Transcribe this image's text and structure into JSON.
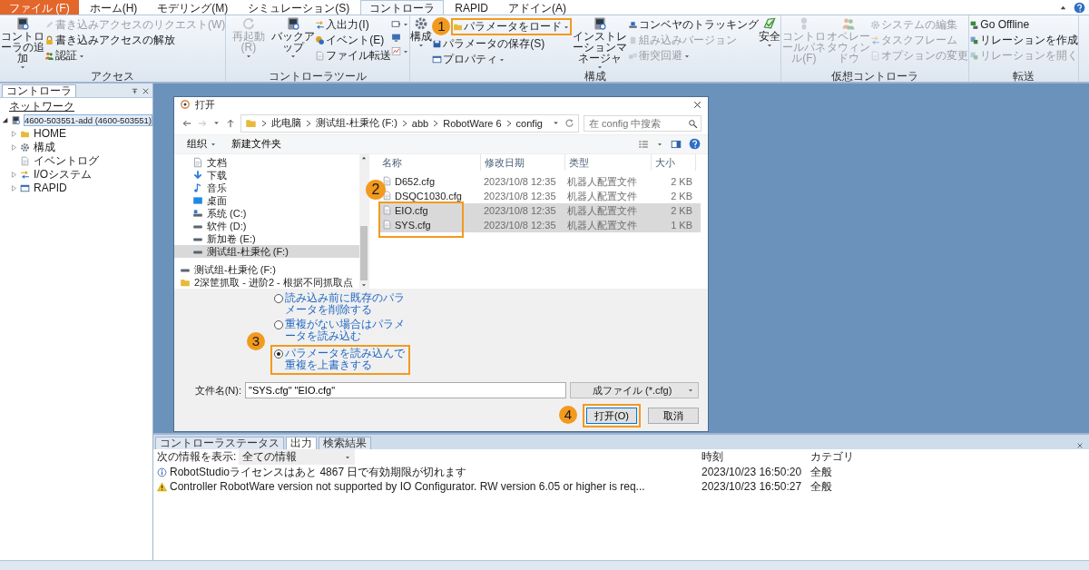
{
  "ribbon": {
    "tabs": [
      {
        "label": "ファイル (F)",
        "kind": "app",
        "selected": false
      },
      {
        "label": "ホーム(H)",
        "kind": "tab",
        "selected": false
      },
      {
        "label": "モデリング(M)",
        "kind": "tab",
        "selected": false
      },
      {
        "label": "シミュレーション(S)",
        "kind": "tab",
        "selected": false
      },
      {
        "label": "コントローラ",
        "kind": "tab",
        "selected": true
      },
      {
        "label": "RAPID",
        "kind": "tab",
        "selected": false
      },
      {
        "label": "アドイン(A)",
        "kind": "tab",
        "selected": false
      }
    ],
    "groups": [
      {
        "title": "アクセス",
        "items": [
          {
            "kind": "large",
            "buttons": [
              {
                "label": "コントローラの追加",
                "disabled": false,
                "dropdown": true
              }
            ]
          },
          {
            "kind": "stack",
            "buttons": [
              {
                "label": "書き込みアクセスのリクエスト(W)",
                "disabled": true,
                "dropdown": false
              },
              {
                "label": "書き込みアクセスの解放",
                "disabled": false,
                "dropdown": false
              },
              {
                "label": "認証",
                "disabled": false,
                "dropdown": true
              }
            ]
          }
        ]
      },
      {
        "title": "コントローラツール",
        "items": [
          {
            "kind": "large",
            "buttons": [
              {
                "label": "再起動(R)",
                "disabled": true,
                "dropdown": true
              }
            ]
          },
          {
            "kind": "large",
            "buttons": [
              {
                "label": "バックアップ",
                "disabled": false,
                "dropdown": true
              }
            ]
          },
          {
            "kind": "stack",
            "buttons": [
              {
                "label": "入出力(I)",
                "disabled": false,
                "dropdown": false
              },
              {
                "label": "イベント(E)",
                "disabled": false,
                "dropdown": false
              },
              {
                "label": "ファイル転送",
                "disabled": false,
                "dropdown": false
              }
            ]
          },
          {
            "kind": "icons",
            "buttons": [
              {
                "disabled": false,
                "dropdown": true
              },
              {
                "disabled": false,
                "dropdown": false
              },
              {
                "disabled": false,
                "dropdown": true
              }
            ]
          }
        ]
      },
      {
        "title": "構成",
        "items": [
          {
            "kind": "large",
            "buttons": [
              {
                "label": "構成",
                "disabled": false,
                "dropdown": true
              }
            ]
          },
          {
            "kind": "stack",
            "buttons": [
              {
                "label": "パラメータをロード",
                "disabled": false,
                "dropdown": true,
                "callout": "1"
              },
              {
                "label": "パラメータの保存(S)",
                "disabled": false,
                "dropdown": false
              },
              {
                "label": "プロパティ",
                "disabled": false,
                "dropdown": true
              }
            ]
          },
          {
            "kind": "large",
            "buttons": [
              {
                "label": "インストレーションマネージャ",
                "disabled": false,
                "dropdown": true
              }
            ]
          },
          {
            "kind": "stack",
            "buttons": [
              {
                "label": "コンベヤのトラッキング",
                "disabled": false,
                "dropdown": false
              },
              {
                "label": "組み込みバージョン",
                "disabled": true,
                "dropdown": false
              },
              {
                "label": "衝突回避",
                "disabled": true,
                "dropdown": true
              }
            ]
          },
          {
            "kind": "large",
            "buttons": [
              {
                "label": "安全",
                "disabled": false,
                "dropdown": true
              }
            ]
          }
        ]
      },
      {
        "title": "仮想コントローラ",
        "items": [
          {
            "kind": "large",
            "buttons": [
              {
                "label": "コントロールパネル(F)",
                "disabled": true,
                "dropdown": false
              }
            ]
          },
          {
            "kind": "large",
            "buttons": [
              {
                "label": "オペレータウィンドウ",
                "disabled": true,
                "dropdown": false
              }
            ]
          },
          {
            "kind": "stack",
            "buttons": [
              {
                "label": "システムの編集",
                "disabled": true,
                "dropdown": false
              },
              {
                "label": "タスクフレーム",
                "disabled": true,
                "dropdown": false
              },
              {
                "label": "オプションの変更",
                "disabled": true,
                "dropdown": false
              }
            ]
          }
        ]
      },
      {
        "title": "転送",
        "items": [
          {
            "kind": "stack",
            "buttons": [
              {
                "label": "Go Offline",
                "disabled": false,
                "dropdown": false
              },
              {
                "label": "リレーションを作成",
                "disabled": false,
                "dropdown": false
              },
              {
                "label": "リレーションを開く",
                "disabled": true,
                "dropdown": false
              }
            ]
          }
        ]
      }
    ]
  },
  "controller_panel": {
    "title": "コントローラ",
    "tree": [
      {
        "label": "ネットワーク",
        "children": [
          {
            "label": "4600-503551-add (4600-503551)",
            "selected": true,
            "expanded": true,
            "children": [
              {
                "label": "HOME",
                "selected": false,
                "expanded": false
              },
              {
                "label": "構成",
                "selected": false,
                "expanded": false
              },
              {
                "label": "イベントログ",
                "selected": false
              },
              {
                "label": "I/Oシステム",
                "selected": false,
                "expanded": false
              },
              {
                "label": "RAPID",
                "selected": false,
                "expanded": false
              }
            ]
          }
        ]
      }
    ]
  },
  "dialog": {
    "title": "打开",
    "path": [
      "此电脑",
      "测试组-杜秉伦 (F:)",
      "abb",
      "RobotWare 6",
      "config"
    ],
    "search": {
      "placeholder": "在 config 中搜索"
    },
    "toolbar": [
      "组织",
      "新建文件夹"
    ],
    "nav": [
      {
        "label": "文档",
        "kind": "doc",
        "selected": false
      },
      {
        "label": "下载",
        "kind": "download",
        "selected": false
      },
      {
        "label": "音乐",
        "kind": "music",
        "selected": false
      },
      {
        "label": "桌面",
        "kind": "desktop",
        "selected": false
      },
      {
        "label": "系统 (C:)",
        "kind": "system",
        "selected": false
      },
      {
        "label": "软件 (D:)",
        "kind": "drive",
        "selected": false
      },
      {
        "label": "新加卷 (E:)",
        "kind": "drive",
        "selected": false
      },
      {
        "label": "测试组-杜秉伦 (F:)",
        "kind": "drive",
        "selected": true
      },
      {
        "label": "测试组-杜秉伦 (F:)",
        "kind": "drive",
        "selected": false
      },
      {
        "label": "2深筐抓取 - 进阶2 - 根据不同抓取点",
        "kind": "folder",
        "selected": false
      }
    ],
    "columns": [
      "名称",
      "修改日期",
      "类型",
      "大小"
    ],
    "files": [
      {
        "name": "D652.cfg",
        "date": "2023/10/8 12:35",
        "type": "机器人配置文件",
        "size": "2 KB",
        "selected": false
      },
      {
        "name": "DSQC1030.cfg",
        "date": "2023/10/8 12:35",
        "type": "机器人配置文件",
        "size": "2 KB",
        "selected": false
      },
      {
        "name": "EIO.cfg",
        "date": "2023/10/8 12:35",
        "type": "机器人配置文件",
        "size": "2 KB",
        "selected": true
      },
      {
        "name": "SYS.cfg",
        "date": "2023/10/8 12:35",
        "type": "机器人配置文件",
        "size": "1 KB",
        "selected": true
      }
    ],
    "files_callout": "2",
    "options": [
      {
        "label": "読み込み前に既存のパラメータを削除する",
        "selected": false
      },
      {
        "label": "重複がない場合はパラメータを読み込む",
        "selected": false
      },
      {
        "label": "パラメータを読み込んで重複を上書きする",
        "selected": true,
        "callout": "3"
      }
    ],
    "filename_label": "文件名(N):",
    "filename": "\"SYS.cfg\" \"EIO.cfg\"",
    "filter": "成ファイル (*.cfg)",
    "buttons": [
      {
        "label": "打开(O)",
        "kind": "primary",
        "callout": "4"
      },
      {
        "label": "取消",
        "kind": "normal"
      }
    ]
  },
  "output": {
    "tabs": [
      {
        "label": "コントローラステータス",
        "selected": false
      },
      {
        "label": "出力",
        "selected": true
      },
      {
        "label": "検索結果",
        "selected": false
      }
    ],
    "filter_label": "次の情報を表示:",
    "filter": "全ての情報",
    "columns": [
      "時刻",
      "カテゴリ"
    ],
    "rows": [
      {
        "kind": "info",
        "message": "RobotStudioライセンスはあと 4867 日で有効期限が切れます",
        "time": "2023/10/23 16:50:20",
        "category": "全般"
      },
      {
        "kind": "warning",
        "message": "Controller RobotWare version not supported by IO Configurator. RW version 6.05 or higher is req...",
        "time": "2023/10/23 16:50:27",
        "category": "全般"
      }
    ]
  }
}
